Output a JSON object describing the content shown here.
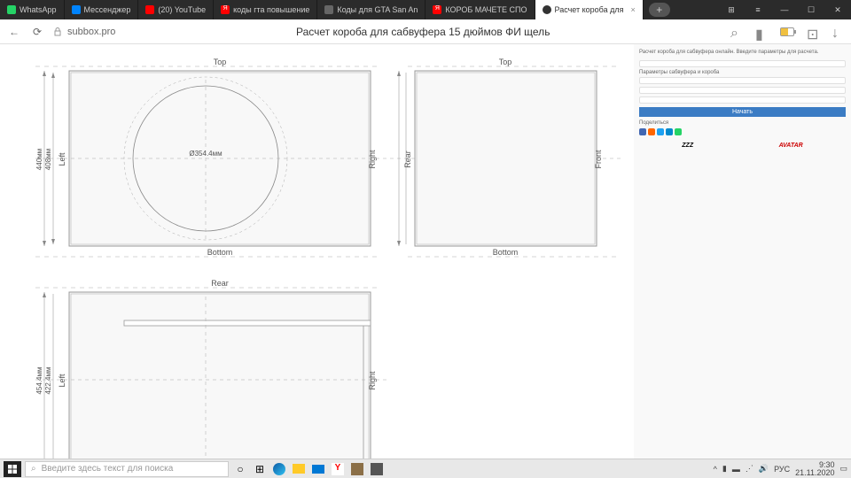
{
  "tabs": [
    {
      "label": "WhatsApp",
      "color": "#25d366"
    },
    {
      "label": "Мессенджер",
      "color": "#0084ff"
    },
    {
      "label": "(20) YouTube",
      "color": "#ff0000"
    },
    {
      "label": "коды гта повышение",
      "color": "#ff0000"
    },
    {
      "label": "Коды для GTA San An",
      "color": "#888"
    },
    {
      "label": "КОРОБ МАЧЕТЕ СПО",
      "color": "#ff0000"
    },
    {
      "label": "Расчет короба для",
      "color": "#333",
      "active": true
    }
  ],
  "url": "subbox.pro",
  "pageTitle": "Расчет короба для сабвуфера 15 дюймов ФИ щель",
  "drawing": {
    "view1": {
      "top": "Top",
      "bottom": "Bottom",
      "left": "Left",
      "right": "Right",
      "height": "440мм",
      "innerH": "408мм",
      "diameter": "Ø354.4мм"
    },
    "view2": {
      "top": "Top",
      "bottom": "Bottom",
      "left": "Rear",
      "right": "Front"
    },
    "view3": {
      "top": "Rear",
      "left": "Left",
      "right": "Right",
      "height": "454.4мм",
      "innerH": "422.4мм"
    }
  },
  "sidebar": {
    "button": "Начать",
    "brands": [
      "ZZZ",
      "AVATAR"
    ]
  },
  "taskbar": {
    "searchPlaceholder": "Введите здесь текст для поиска",
    "lang": "РУС",
    "time": "9:30",
    "date": "21.11.2020"
  }
}
